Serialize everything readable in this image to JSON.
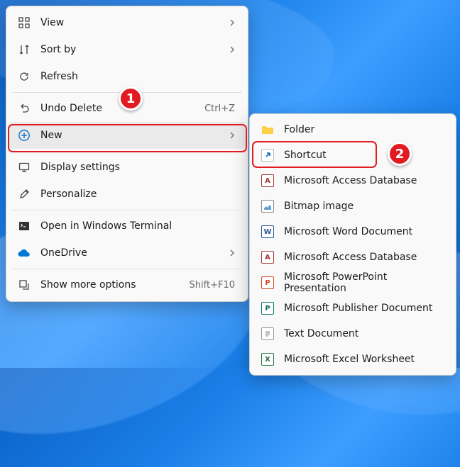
{
  "main_menu": {
    "view": {
      "label": "View"
    },
    "sort_by": {
      "label": "Sort by"
    },
    "refresh": {
      "label": "Refresh"
    },
    "undo_delete": {
      "label": "Undo Delete",
      "shortcut": "Ctrl+Z"
    },
    "new": {
      "label": "New"
    },
    "display": {
      "label": "Display settings"
    },
    "personalize": {
      "label": "Personalize"
    },
    "terminal": {
      "label": "Open in Windows Terminal"
    },
    "onedrive": {
      "label": "OneDrive"
    },
    "more": {
      "label": "Show more options",
      "shortcut": "Shift+F10"
    }
  },
  "sub_menu": {
    "folder": {
      "label": "Folder"
    },
    "shortcut": {
      "label": "Shortcut"
    },
    "access1": {
      "label": "Microsoft Access Database"
    },
    "bitmap": {
      "label": "Bitmap image"
    },
    "word": {
      "label": "Microsoft Word Document"
    },
    "access2": {
      "label": "Microsoft Access Database"
    },
    "ppt": {
      "label": "Microsoft PowerPoint Presentation"
    },
    "pub": {
      "label": "Microsoft Publisher Document"
    },
    "text": {
      "label": "Text Document"
    },
    "excel": {
      "label": "Microsoft Excel Worksheet"
    }
  },
  "annotations": {
    "step1": "1",
    "step2": "2"
  }
}
